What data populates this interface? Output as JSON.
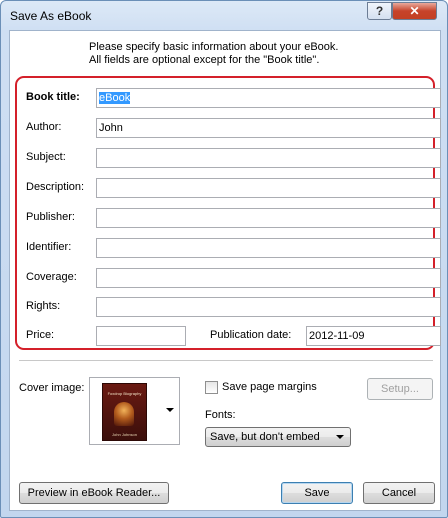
{
  "window": {
    "title": "Save As eBook",
    "help_label": "?",
    "close_label": "✕"
  },
  "intro": {
    "line1": "Please specify basic information about your eBook.",
    "line2": "All fields are optional except for the \"Book title\"."
  },
  "fields": {
    "book_title": {
      "label": "Book title:",
      "value": "eBook"
    },
    "author": {
      "label": "Author:",
      "value": "John"
    },
    "subject": {
      "label": "Subject:",
      "value": ""
    },
    "description": {
      "label": "Description:",
      "value": ""
    },
    "publisher": {
      "label": "Publisher:",
      "value": ""
    },
    "identifier": {
      "label": "Identifier:",
      "value": ""
    },
    "coverage": {
      "label": "Coverage:",
      "value": ""
    },
    "rights": {
      "label": "Rights:",
      "value": ""
    },
    "price": {
      "label": "Price:",
      "value": ""
    },
    "publication_date": {
      "label": "Publication date:",
      "value": "2012-11-09"
    }
  },
  "cover": {
    "label": "Cover image:",
    "book_title_text": "Foxdrop Biography",
    "book_author_text": "John Johnson"
  },
  "options": {
    "save_margins_label": "Save page margins",
    "save_margins_checked": false,
    "setup_label": "Setup...",
    "fonts_label": "Fonts:",
    "fonts_value": "Save, but don't embed"
  },
  "buttons": {
    "preview_label": "Preview in eBook Reader...",
    "save_label": "Save",
    "cancel_label": "Cancel"
  },
  "colors": {
    "highlight_border": "#d4202a",
    "selection": "#3399ff"
  }
}
